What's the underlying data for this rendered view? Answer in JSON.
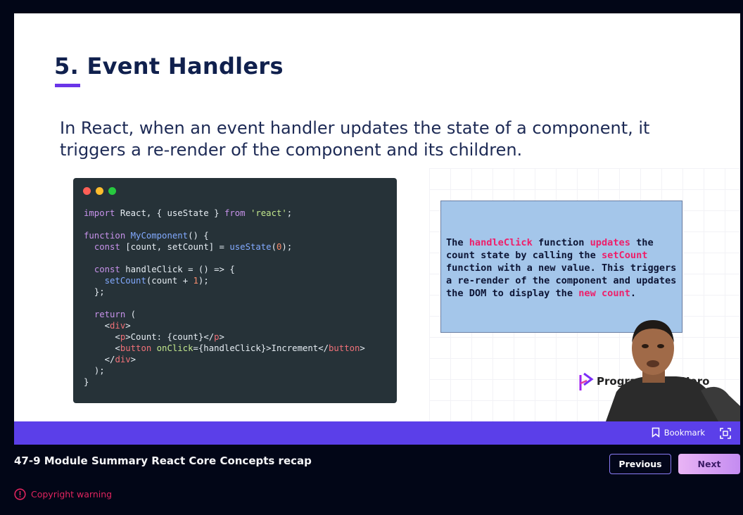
{
  "slide": {
    "title": "5. Event Handlers",
    "intro_line1": "In React, when an event handler updates the state of a component, it",
    "intro_line2": "triggers a re-render of the component and its children.",
    "note": {
      "t1": "The ",
      "h1": "handleClick",
      "t2": " function ",
      "h2": "updates",
      "t3": " the count state by calling the ",
      "h3": "setCount",
      "t4": " function with a new value. This triggers a re-render of the component and updates the DOM to display the ",
      "h4": "new count",
      "t5": "."
    },
    "brand_name": "Programming Hero"
  },
  "code_lines": [
    "import React, { useState } from 'react';",
    "",
    "function MyComponent() {",
    "  const [count, setCount] = useState(0);",
    "",
    "  const handleClick = () => {",
    "    setCount(count + 1);",
    "  };",
    "",
    "  return (",
    "    <div>",
    "      <p>Count: {count}</p>",
    "      <button onClick={handleClick}>Increment</button>",
    "    </div>",
    "  );",
    "}"
  ],
  "player": {
    "bookmark_label": "Bookmark"
  },
  "lesson": {
    "title": "47-9 Module Summary React Core Concepts recap",
    "previous_label": "Previous",
    "next_label": "Next",
    "copyright_label": "Copyright warning"
  },
  "colors": {
    "accent": "#5b3fe9",
    "highlight": "#ee1f6a",
    "warning": "#e0245e"
  }
}
